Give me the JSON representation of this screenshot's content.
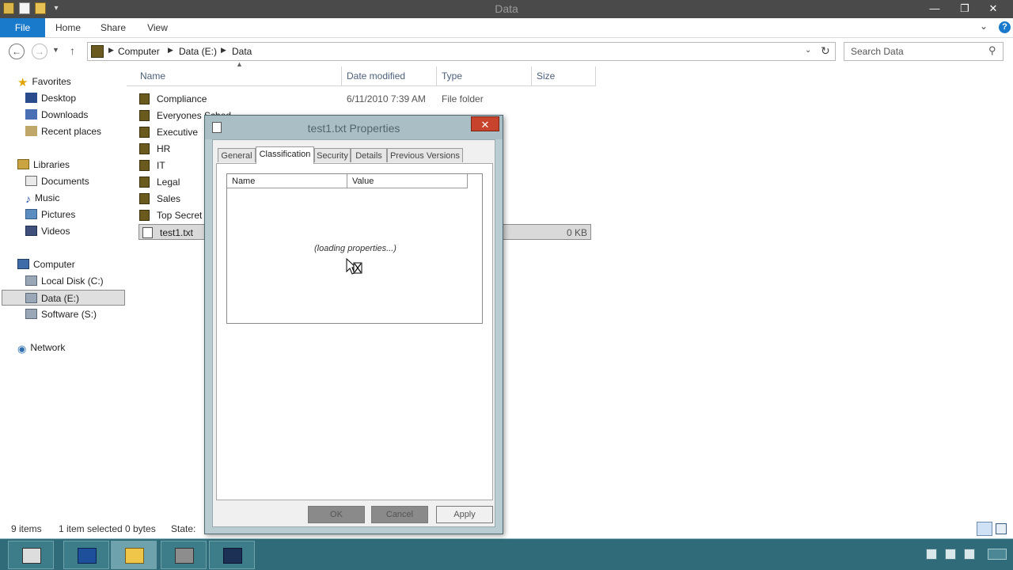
{
  "window": {
    "title": "Data",
    "minimize": "—",
    "maximize": "❐",
    "close": "✕"
  },
  "quick_access": {
    "dropdown_arrow": "▾"
  },
  "ribbon": {
    "tabs": [
      "File",
      "Home",
      "Share",
      "View"
    ],
    "expand_icon": "⌄",
    "help": "?"
  },
  "navigation": {
    "back": "←",
    "forward": "→",
    "recent": "▼",
    "up": "↑",
    "breadcrumb": [
      "Computer",
      "Data (E:)",
      "Data"
    ],
    "crumb_separator": "▶",
    "dropdown": "⌄",
    "refresh": "↻",
    "search_placeholder": "Search Data",
    "search_icon": "⚲"
  },
  "nav_pane": {
    "favorites_label": "Favorites",
    "favorites": [
      "Desktop",
      "Downloads",
      "Recent places"
    ],
    "libraries_label": "Libraries",
    "libraries": [
      "Documents",
      "Music",
      "Pictures",
      "Videos"
    ],
    "computer_label": "Computer",
    "drives": [
      "Local Disk (C:)",
      "Data (E:)",
      "Software (S:)"
    ],
    "selected_drive": "Data (E:)",
    "network_label": "Network",
    "icons": {
      "star": "★",
      "music": "♪",
      "network": "◉"
    }
  },
  "file_list": {
    "columns": [
      "Name",
      "Date modified",
      "Type",
      "Size"
    ],
    "sort_indicator": "▲",
    "rows": [
      {
        "name": "Compliance",
        "date": "6/11/2010 7:39 AM",
        "type": "File folder",
        "size": ""
      },
      {
        "name": "Everyones Sched..",
        "date": "",
        "type": "",
        "size": ""
      },
      {
        "name": "Executive",
        "date": "",
        "type": "",
        "size": ""
      },
      {
        "name": "HR",
        "date": "",
        "type": "",
        "size": ""
      },
      {
        "name": "IT",
        "date": "",
        "type": "",
        "size": ""
      },
      {
        "name": "Legal",
        "date": "",
        "type": "",
        "size": ""
      },
      {
        "name": "Sales",
        "date": "",
        "type": "",
        "size": ""
      },
      {
        "name": "Top Secret",
        "date": "",
        "type": "",
        "size": ""
      },
      {
        "name": "test1.txt",
        "date": "",
        "type": "",
        "size": "0 KB"
      }
    ],
    "selected_row": "test1.txt"
  },
  "status_bar": {
    "item_count": "9 items",
    "selection": "1 item selected",
    "selection_size": "0 bytes",
    "state_label": "State:"
  },
  "dialog": {
    "title": "test1.txt Properties",
    "close": "✕",
    "tabs": [
      "General",
      "Classification",
      "Security",
      "Details",
      "Previous Versions"
    ],
    "active_tab": "Classification",
    "list_columns": [
      "Name",
      "Value"
    ],
    "loading_text": "(loading properties...)",
    "buttons": {
      "ok": "OK",
      "cancel": "Cancel",
      "apply": "Apply"
    }
  },
  "colors": {
    "file_tab": "#1979ca",
    "titlebar": "#4a4a4a",
    "dialog_frame": "#b9ccd2",
    "taskbar": "#2f6b78",
    "close_button": "#c7432b"
  }
}
